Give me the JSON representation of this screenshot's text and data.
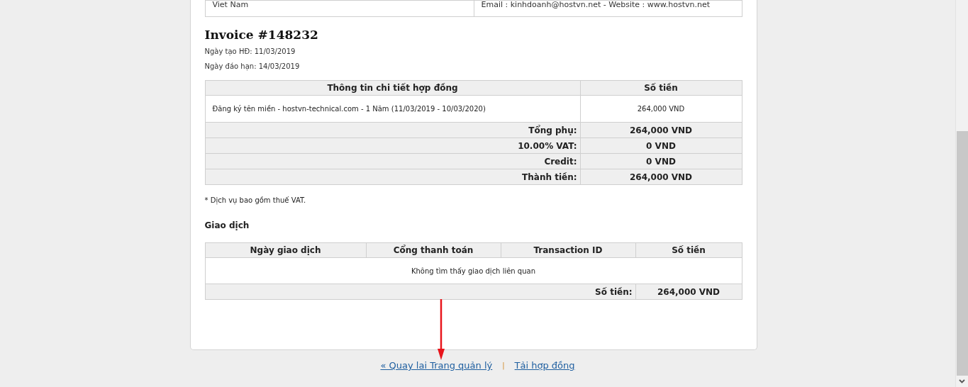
{
  "customer_row": {
    "column_1": "Viet Nam",
    "column_2": "Email : kinhdoanh@hostvn.net - Website : www.hostvn.net"
  },
  "invoice": {
    "title": "Invoice #148232",
    "created": "Ngày tạo HĐ: 11/03/2019",
    "due": "Ngày đáo hạn: 14/03/2019"
  },
  "items_table": {
    "columns": [
      "Thông tin chi tiết hợp đồng",
      "Số tiền"
    ],
    "rows": [
      {
        "description": "Đăng ký tên miền - hostvn-technical.com - 1 Năm (11/03/2019 - 10/03/2020)",
        "amount": "264,000 VND"
      }
    ],
    "totals": [
      {
        "label": "Tổng phụ:",
        "value": "264,000 VND"
      },
      {
        "label": "10.00% VAT:",
        "value": "0 VND"
      },
      {
        "label": "Credit:",
        "value": "0 VND"
      },
      {
        "label": "Thành tiền:",
        "value": "264,000 VND"
      }
    ]
  },
  "note": "* Dịch vụ bao gồm thuế VAT.",
  "transactions": {
    "title": "Giao dịch",
    "columns": [
      "Ngày giao dịch",
      "Cổng thanh toán",
      "Transaction ID",
      "Số tiền"
    ],
    "empty_message": "Không tìm thấy giao dịch liên quan",
    "total_label": "Số tiền:",
    "total_value": "264,000 VND"
  },
  "footer_links": [
    {
      "label": "« Quay lai Trang quản lý"
    },
    {
      "label": "Tải hợp đồng"
    }
  ],
  "footer_separator": "|"
}
